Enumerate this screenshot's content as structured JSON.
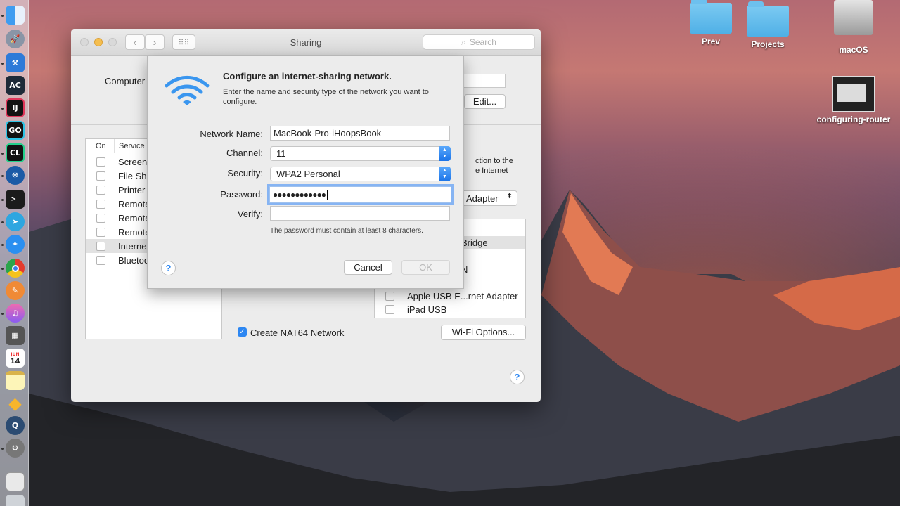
{
  "window": {
    "title": "Sharing",
    "search_placeholder": "Search",
    "computer_label": "Computer",
    "edit_label": "Edit...",
    "services_header": {
      "on": "On",
      "service": "Service"
    },
    "services": [
      "Screen",
      "File Sha",
      "Printer",
      "Remote",
      "Remote",
      "Remote",
      "Internet",
      "Bluetoo"
    ],
    "right_text": [
      "ction to the",
      "e Internet"
    ],
    "adapter_select": "Adapter",
    "ports": [
      "Bridge",
      "N",
      "Apple USB E...rnet Adapter",
      "iPad USB"
    ],
    "nat64_label": "Create NAT64 Network",
    "wifi_options_label": "Wi-Fi Options...",
    "help": "?"
  },
  "sheet": {
    "title": "Configure an internet-sharing network.",
    "description": "Enter the name and security type of the network you want to configure.",
    "fields": {
      "network_name_label": "Network Name:",
      "network_name_value": "MacBook-Pro-iHoopsBook",
      "channel_label": "Channel:",
      "channel_value": "11",
      "security_label": "Security:",
      "security_value": "WPA2 Personal",
      "password_label": "Password:",
      "password_value": "●●●●●●●●●●●●",
      "verify_label": "Verify:",
      "verify_value": ""
    },
    "hint": "The password must contain at least 8 characters.",
    "cancel_label": "Cancel",
    "ok_label": "OK",
    "help": "?"
  },
  "desktop": {
    "icons": [
      "Prev",
      "Projects",
      "macOS",
      "configuring-router"
    ]
  },
  "dock": {
    "apps": [
      "finder-icon",
      "launchpad-icon",
      "xcode-icon",
      "appcode-icon",
      "intellij-icon",
      "goland-icon",
      "clion-icon",
      "sourcetree-icon",
      "terminal-icon",
      "telegram-icon",
      "safari-icon",
      "chrome-icon",
      "instruments-icon",
      "itunes-icon",
      "calculator-icon",
      "calendar-icon",
      "notes-icon",
      "sketch-icon",
      "quicktime-icon",
      "system-preferences-icon",
      "downloads-stack-icon",
      "trash-icon"
    ],
    "labels": {
      "appcode": "AC",
      "intellij": "IJ",
      "goland": "GO",
      "clion": "CL",
      "calendar_day": "14",
      "calendar_month": "JUN"
    }
  },
  "colors": {
    "accent": "#2d87f2",
    "window_bg": "#ececec"
  }
}
